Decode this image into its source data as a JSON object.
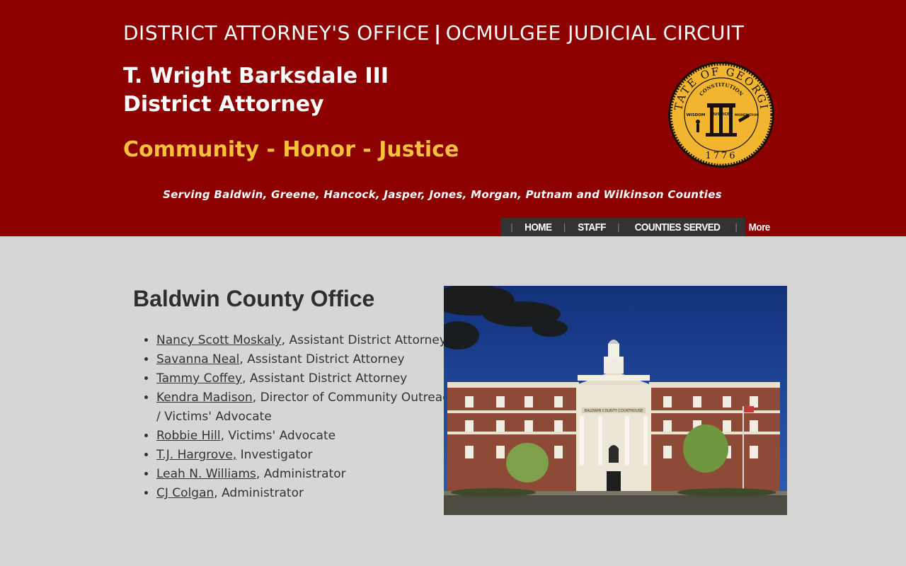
{
  "header": {
    "office_part1": "DISTRICT ATTORNEY'S OFFICE",
    "office_sep": "|",
    "office_part2": "OCMULGEE JUDICIAL CIRCUIT",
    "da_name": "T. Wright Barksdale III",
    "da_title": "District Attorney",
    "motto": "Community - Honor - Justice",
    "serving": "Serving Baldwin, Greene, Hancock, Jasper, Jones, Morgan, Putnam and Wilkinson Counties",
    "seal": {
      "text_top": "STATE OF GEORGIA",
      "banner": "CONSTITUTION",
      "wisdom": "WISDOM",
      "justice": "JUSTICE",
      "moderation": "MODERATION",
      "year": "1776"
    }
  },
  "nav": {
    "sep": "|",
    "items": [
      {
        "label": "HOME"
      },
      {
        "label": "STAFF"
      },
      {
        "label": "COUNTIES SERVED"
      },
      {
        "label": "More"
      }
    ]
  },
  "main": {
    "title": "Baldwin County Office",
    "staff": [
      {
        "name": "Nancy Scott Moskaly",
        "role": ", Assistant District Attorney"
      },
      {
        "name": "Savanna Neal",
        "role": ", Assistant District Attorney"
      },
      {
        "name": "Tammy Coffey",
        "role": ", Assistant District Attorney"
      },
      {
        "name": "Kendra Madison",
        "role": ", Director of Community Outreach / Victims' Advocate"
      },
      {
        "name": "Robbie Hill",
        "role": ", Victims' Advocate"
      },
      {
        "name": "T.J. Hargrove,",
        "role": " Investigator"
      },
      {
        "name": "Leah N. Williams",
        "role": ", Administrator"
      },
      {
        "name": "CJ Colgan",
        "role": ", Administrator"
      }
    ],
    "photo_sign": "BALDWIN COUNTY COURTHOUSE"
  },
  "colors": {
    "header_bg": "#8d0000",
    "motto": "#f6c13c",
    "nav_bg": "#333333",
    "page_bg": "#d6d6d6",
    "seal_gold": "#f2b530"
  }
}
